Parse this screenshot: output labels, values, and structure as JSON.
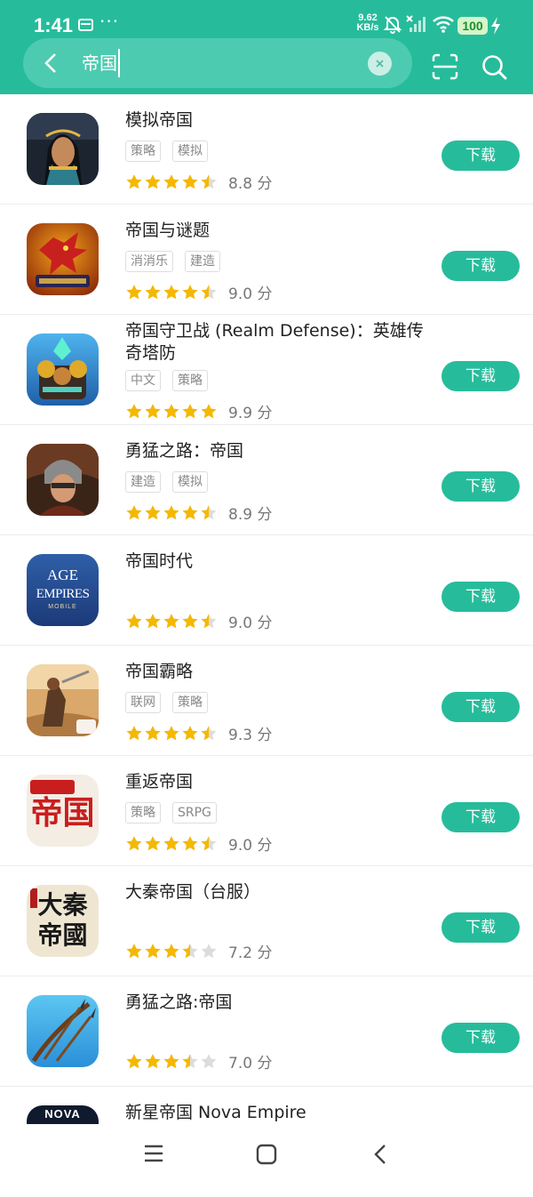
{
  "status_bar": {
    "time": "1:41",
    "more": "···",
    "net_speed_value": "9.62",
    "net_speed_unit": "KB/s",
    "battery": "100",
    "icons": [
      "sim-card-icon",
      "mute-icon",
      "signal-icon",
      "wifi-icon",
      "battery-icon",
      "charging-icon"
    ]
  },
  "search": {
    "query": "帝国",
    "icons": [
      "back-icon",
      "clear-icon",
      "scan-icon",
      "search-icon"
    ]
  },
  "colors": {
    "accent": "#26bc9b",
    "star": "#f5b800",
    "star_empty": "#dcdcdc"
  },
  "download_label": "下载",
  "score_unit": "分",
  "apps": [
    {
      "name": "模拟帝国",
      "tags": [
        "策略",
        "模拟"
      ],
      "stars": 4.5,
      "score": "8.8",
      "icon": "pharaoh-queen-icon"
    },
    {
      "name": "帝国与谜题",
      "tags": [
        "消消乐",
        "建造"
      ],
      "stars": 4.5,
      "score": "9.0",
      "icon": "red-dragon-icon"
    },
    {
      "name": "帝国守卫战 (Realm Defense)：英雄传奇塔防",
      "tags": [
        "中文",
        "策略"
      ],
      "stars": 5,
      "score": "9.9",
      "icon": "tower-crystal-icon"
    },
    {
      "name": "勇猛之路：帝国",
      "tags": [
        "建造",
        "模拟"
      ],
      "stars": 4.5,
      "score": "8.9",
      "icon": "warrior-woman-icon"
    },
    {
      "name": "帝国时代",
      "tags": [],
      "stars": 4.5,
      "score": "9.0",
      "icon": "age-of-empires-logo-icon",
      "icon_text": [
        "AGE",
        "EMPIRES",
        "MOBILE"
      ]
    },
    {
      "name": "帝国霸略",
      "tags": [
        "联网",
        "策略"
      ],
      "stars": 4.5,
      "score": "9.3",
      "icon": "battle-horseman-icon"
    },
    {
      "name": "重返帝国",
      "tags": [
        "策略",
        "SRPG"
      ],
      "stars": 4.5,
      "score": "9.0",
      "icon": "return-empire-logo-icon",
      "icon_text": [
        "帝国"
      ]
    },
    {
      "name": "大秦帝国（台服）",
      "tags": [],
      "stars": 3.5,
      "score": "7.2",
      "icon": "daqin-calligraphy-icon",
      "icon_text": [
        "大秦",
        "帝國"
      ]
    },
    {
      "name": "勇猛之路:帝国",
      "tags": [],
      "stars": 3.5,
      "score": "7.0",
      "icon": "crossed-spears-icon"
    },
    {
      "name": "新星帝国 Nova Empire",
      "tags": [],
      "stars": 0,
      "score": "",
      "icon": "nova-empire-logo-icon",
      "icon_text": [
        "NOVA"
      ]
    }
  ],
  "nav_bar": {
    "icons": [
      "menu-icon",
      "home-icon",
      "back-nav-icon"
    ]
  }
}
